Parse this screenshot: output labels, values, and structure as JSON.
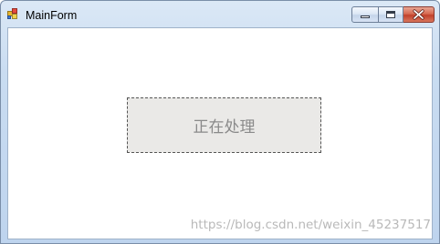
{
  "window": {
    "title": "MainForm",
    "colors": {
      "frame": "#bed4ee",
      "close_button": "#c1412b",
      "client_background": "#ffffff"
    },
    "icons": {
      "app": "app-icon",
      "minimize": "minimize-icon",
      "maximize": "maximize-icon",
      "close": "close-icon"
    }
  },
  "content": {
    "status_button_label": "正在处理",
    "status_button_background": "#eae9e7"
  },
  "watermark": "https://blog.csdn.net/weixin_45237517"
}
